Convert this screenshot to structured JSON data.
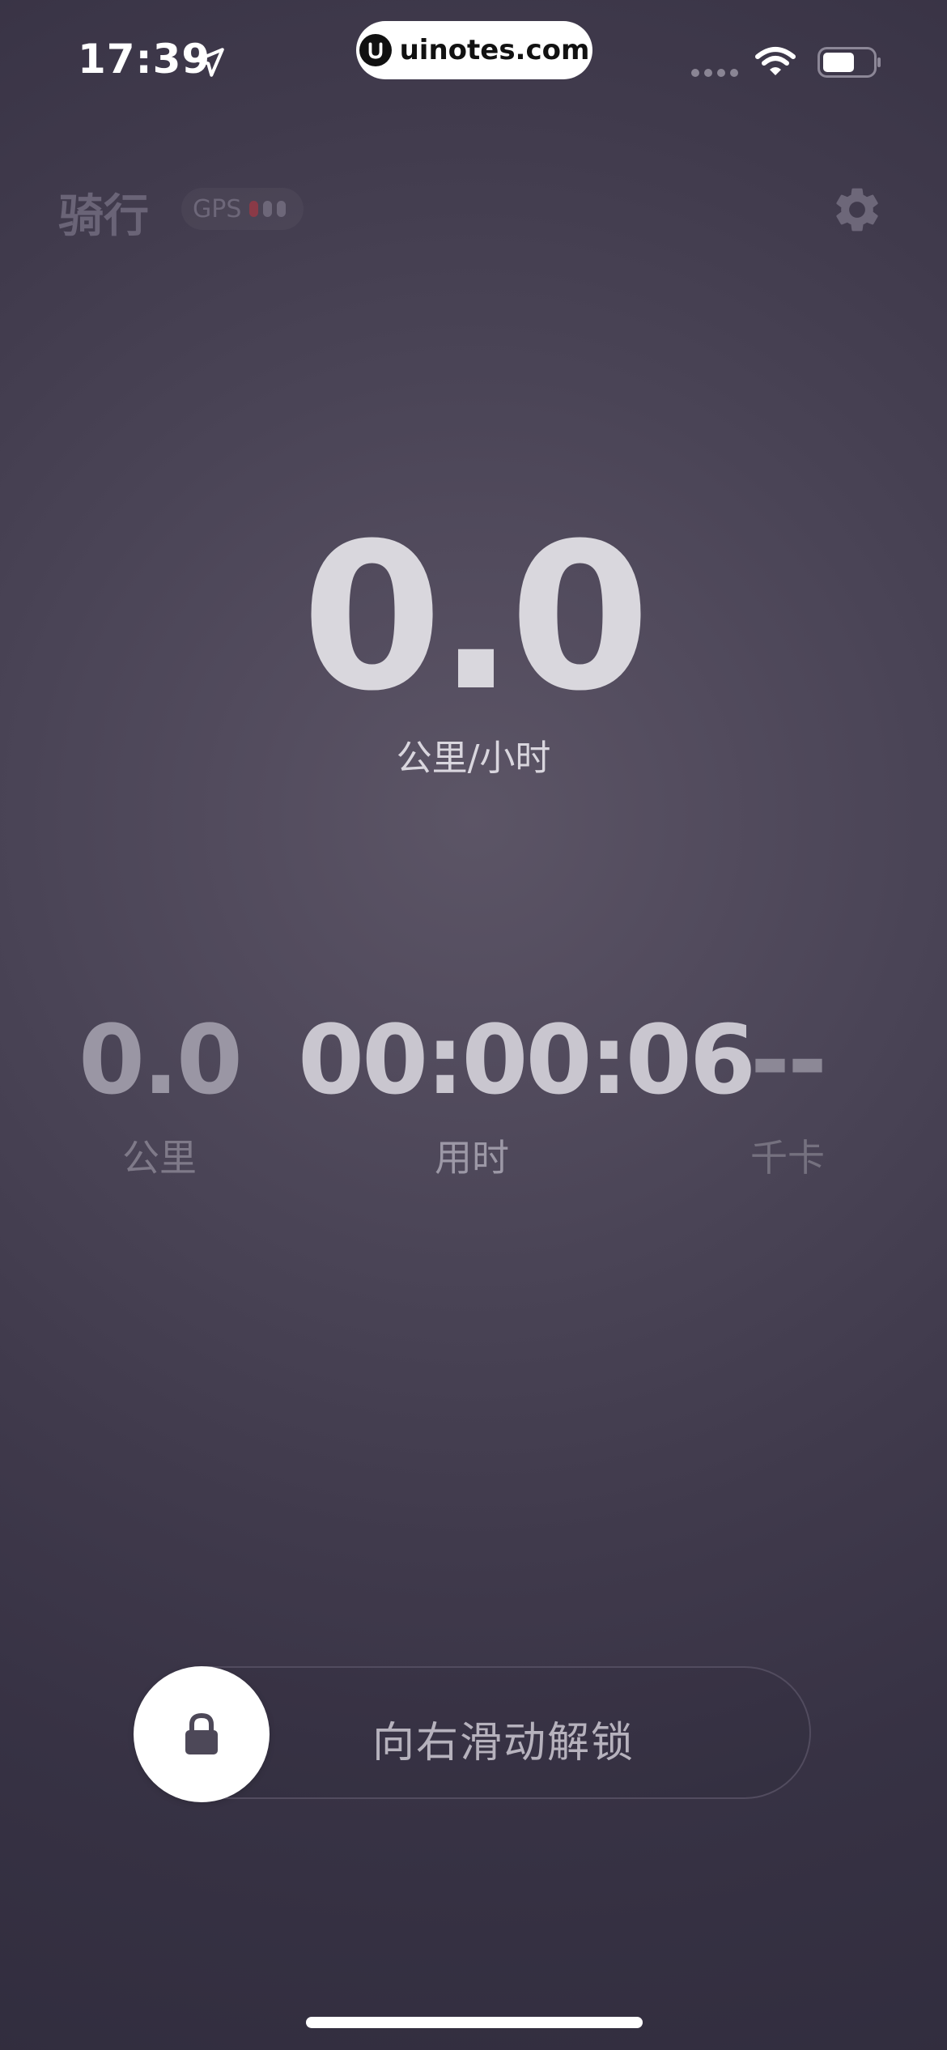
{
  "status_bar": {
    "time": "17:39",
    "watermark": "uinotes.com"
  },
  "header": {
    "title": "骑行",
    "gps_label": "GPS"
  },
  "speed": {
    "value": "0.0",
    "unit": "公里/小时"
  },
  "stats": {
    "distance": {
      "value": "0.0",
      "label": "公里"
    },
    "duration": {
      "value": "00:00:06",
      "label": "用时"
    },
    "calories": {
      "value": "--",
      "label": "千卡"
    }
  },
  "unlock": {
    "label": "向右滑动解锁"
  },
  "icons": {
    "location": "location-arrow-icon",
    "wifi": "wifi-icon",
    "battery": "battery-icon",
    "settings": "gear-icon",
    "lock": "lock-icon"
  },
  "colors": {
    "background": "#3f3a4c",
    "gps_signal_active": "#8a3a47",
    "unlock_handle": "#ffffff"
  }
}
